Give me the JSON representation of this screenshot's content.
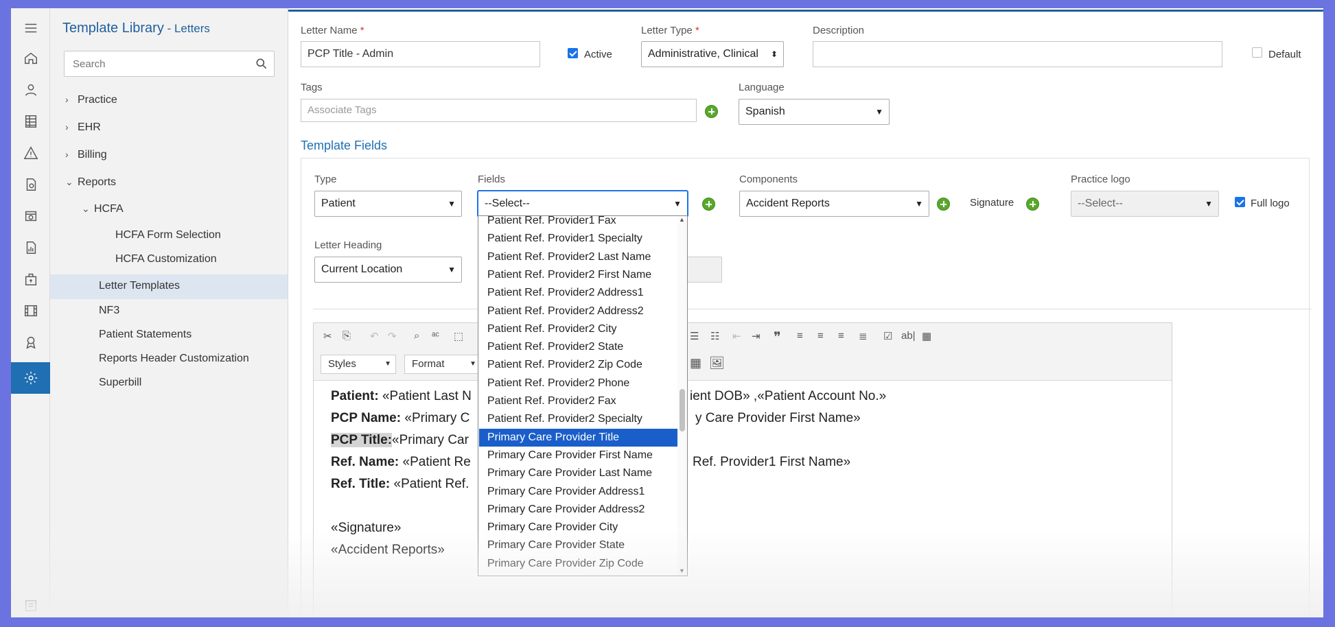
{
  "tree": {
    "title": "Template Library",
    "title_sub": " - Letters",
    "search_placeholder": "Search",
    "nodes": [
      "Practice",
      "EHR",
      "Billing",
      "Reports"
    ],
    "hcfa": "HCFA",
    "hcfa_children": [
      "HCFA Form Selection",
      "HCFA Customization"
    ],
    "report_items": [
      "Letter Templates",
      "NF3",
      "Patient Statements",
      "Reports Header Customization",
      "Superbill"
    ]
  },
  "form": {
    "letter_name_label": "Letter Name",
    "letter_name_value": "PCP Title - Admin",
    "active_label": "Active",
    "letter_type_label": "Letter Type",
    "letter_type_value": "Administrative, Clinical",
    "description_label": "Description",
    "default_label": "Default",
    "tags_label": "Tags",
    "tags_placeholder": "Associate Tags",
    "language_label": "Language",
    "language_value": "Spanish",
    "required_mark": "*"
  },
  "template_fields": {
    "title": "Template Fields",
    "type_label": "Type",
    "type_value": "Patient",
    "fields_label": "Fields",
    "fields_value": "--Select--",
    "components_label": "Components",
    "components_value": "Accident Reports",
    "signature_label": "Signature",
    "practice_logo_label": "Practice logo",
    "practice_logo_value": "--Select--",
    "full_logo_label": "Full logo",
    "letter_heading_label": "Letter Heading",
    "letter_heading_value": "Current Location"
  },
  "toolbar": {
    "styles": "Styles",
    "format": "Format"
  },
  "content": {
    "l1_label": "Patient:",
    "l1_text": " «Patient Last N",
    "l1_tail": "ient DOB» ,«Patient Account No.»",
    "l2_label": "PCP Name:",
    "l2_text": " «Primary C",
    "l2_tail": "y Care Provider First Name»",
    "l3_label": "PCP Title:",
    "l3_text": "«Primary Car",
    "l4_label": "Ref. Name:",
    "l4_text": " «Patient Re",
    "l4_tail": "Ref. Provider1 First Name»",
    "l5_label": "Ref. Title:",
    "l5_text": " «Patient Ref.",
    "signature": "«Signature»",
    "accident": "«Accident Reports»"
  },
  "dropdown_items": [
    "Patient Ref. Provider1 Fax",
    "Patient Ref. Provider1 Specialty",
    "Patient Ref. Provider2 Last Name",
    "Patient Ref. Provider2 First Name",
    "Patient Ref. Provider2 Address1",
    "Patient Ref. Provider2 Address2",
    "Patient Ref. Provider2 City",
    "Patient Ref. Provider2 State",
    "Patient Ref. Provider2 Zip Code",
    "Patient Ref. Provider2 Phone",
    "Patient Ref. Provider2 Fax",
    "Patient Ref. Provider2 Specialty",
    "Primary Care Provider Title",
    "Primary Care Provider First Name",
    "Primary Care Provider Last Name",
    "Primary Care Provider Address1",
    "Primary Care Provider Address2",
    "Primary Care Provider City",
    "Primary Care Provider State",
    "Primary Care Provider Zip Code"
  ],
  "dropdown_selected_index": 12,
  "colors": {
    "accent": "#1f6fb2",
    "selected": "#1a5ec9",
    "add": "#58a82c"
  }
}
